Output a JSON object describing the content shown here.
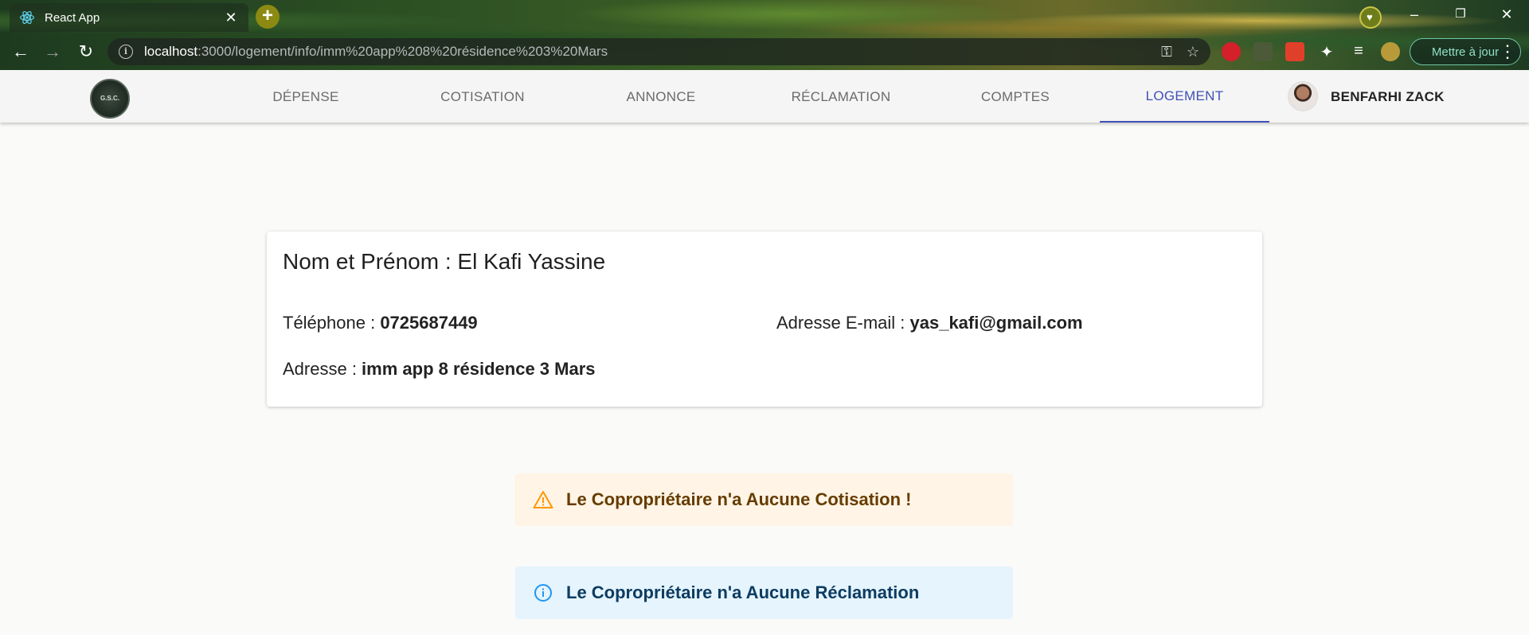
{
  "browser": {
    "tab_title": "React App",
    "url_host": "localhost",
    "url_path": ":3000/logement/info/imm%20app%208%20résidence%203%20Mars",
    "update_label": "Mettre à jour"
  },
  "navbar": {
    "logo_text": "G.S.C.",
    "items": [
      {
        "label": "DÉPENSE"
      },
      {
        "label": "COTISATION"
      },
      {
        "label": "ANNONCE"
      },
      {
        "label": "RÉCLAMATION"
      },
      {
        "label": "COMPTES"
      },
      {
        "label": "LOGEMENT",
        "active": true
      }
    ],
    "user_name": "BENFARHI ZACK",
    "accent_color": "#3f51b5"
  },
  "owner": {
    "title": "Nom et Prénom : El Kafi Yassine",
    "phone_label": "Téléphone : ",
    "phone_value": "0725687449",
    "email_label": "Adresse E-mail : ",
    "email_value": "yas_kafi@gmail.com",
    "address_label": "Adresse : ",
    "address_value": "imm app 8 résidence 3 Mars"
  },
  "alerts": {
    "cotisation": {
      "text": "Le Copropriétaire n'a Aucune Cotisation !",
      "icon": "warning-icon",
      "color": "#ff9800"
    },
    "reclamation": {
      "text": "Le Copropriétaire n'a Aucune Réclamation",
      "icon": "info-icon",
      "color": "#2196f3"
    }
  }
}
